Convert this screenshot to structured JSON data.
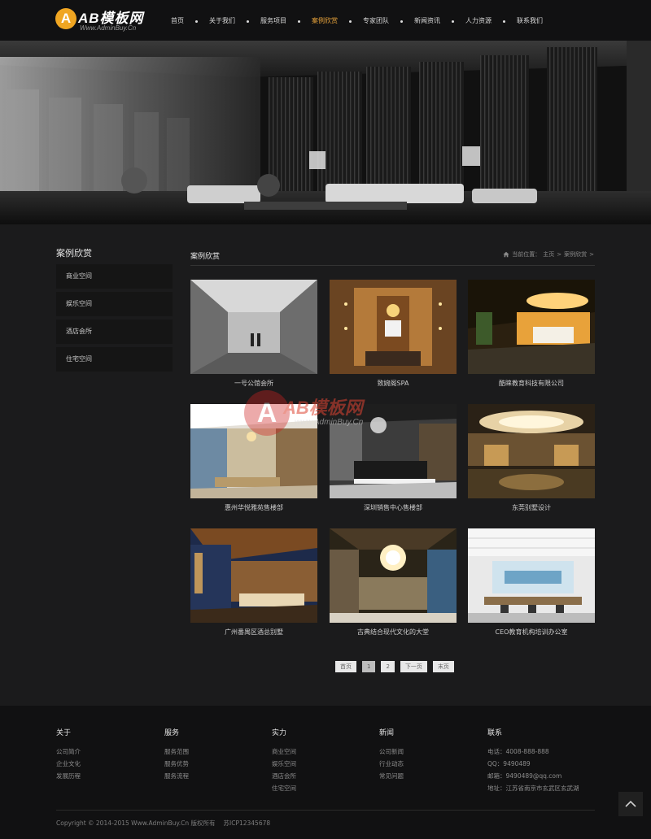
{
  "header": {
    "logo_text": "AB模板网",
    "logo_sub": "Www.AdminBuy.Cn",
    "nav": [
      {
        "label": "首页",
        "active": false
      },
      {
        "label": "关于我们",
        "active": false
      },
      {
        "label": "服务项目",
        "active": false
      },
      {
        "label": "案例欣赏",
        "active": true
      },
      {
        "label": "专家团队",
        "active": false
      },
      {
        "label": "新闻资讯",
        "active": false
      },
      {
        "label": "人力资源",
        "active": false
      },
      {
        "label": "联系我们",
        "active": false
      }
    ]
  },
  "sidebar": {
    "title": "案例欣赏",
    "items": [
      "商业空间",
      "娱乐空间",
      "酒店会所",
      "住宅空间"
    ]
  },
  "main": {
    "title": "案例欣赏",
    "breadcrumb": {
      "prefix": "当前位置：",
      "home": "主页",
      "sep": ">",
      "current": "案例欣赏"
    },
    "cases": [
      "一号公馆会所",
      "致婉阁SPA",
      "酷睐教育科技有限公司",
      "惠州华悦雅苑售楼部",
      "深圳销售中心售楼部",
      "东莞别墅设计",
      "广州番禺区酒总别墅",
      "古典结合现代文化的大堂",
      "CEO教育机构培训办公室"
    ],
    "pager": [
      "首页",
      "1",
      "2",
      "下一页",
      "末页"
    ],
    "current_page": "1"
  },
  "watermark": {
    "text": "AB模板网",
    "sub": "www.AdminBuy.Cn"
  },
  "footer": {
    "columns": [
      {
        "title": "关于",
        "links": [
          "公司简介",
          "企业文化",
          "发展历程"
        ]
      },
      {
        "title": "服务",
        "links": [
          "服务范围",
          "服务优势",
          "服务流程"
        ]
      },
      {
        "title": "实力",
        "links": [
          "商业空间",
          "娱乐空间",
          "酒店会所",
          "住宅空间"
        ]
      },
      {
        "title": "新闻",
        "links": [
          "公司新闻",
          "行业动态",
          "常见问题"
        ]
      },
      {
        "title": "联系",
        "links": [
          "电话：4008-888-888",
          "QQ：9490489",
          "邮箱：9490489@qq.com",
          "地址：江苏省南京市玄武区玄武湖"
        ]
      }
    ],
    "copyright": "Copyright © 2014-2015 Www.AdminBuy.Cn 版权所有",
    "icp": "苏ICP12345678"
  },
  "colors": {
    "accent": "#e9a43b",
    "background": "#1b1b1c",
    "header": "#111112"
  }
}
